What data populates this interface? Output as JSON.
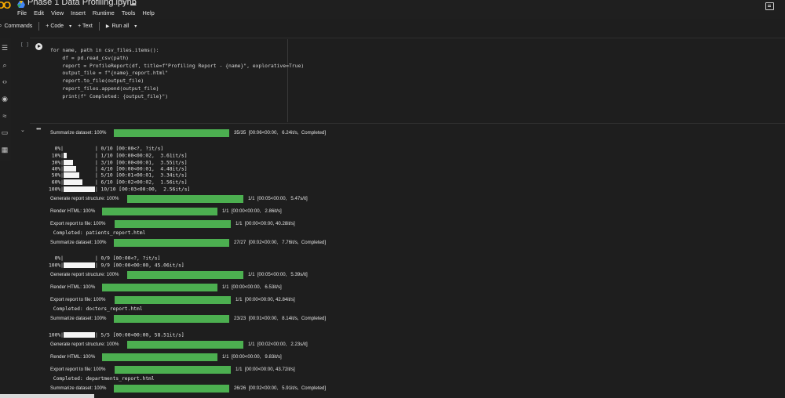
{
  "app": {
    "title": "Phase 1 Data Profiling.ipynb"
  },
  "menu": [
    "File",
    "Edit",
    "View",
    "Insert",
    "Runtime",
    "Tools",
    "Help"
  ],
  "toolbar": {
    "commands_label": "Commands",
    "code_label": "+ Code",
    "text_label": "+ Text",
    "run_all_label": "Run all"
  },
  "cell": {
    "bracket": "[ ]",
    "code_lines": [
      "for name, path in csv_files.items():",
      "    df = pd.read_csv(path)",
      "    report = ProfileReport(df, title=f\"Profiling Report - {name}\", explorative=True)",
      "    output_file = f\"{name}_report.html\"",
      "    report.to_file(output_file)",
      "    report_files.append(output_file)",
      "    print(f\" Completed: {output_file}\")"
    ]
  },
  "output": {
    "menu_glyph": "•••",
    "rows": [
      {
        "type": "progress",
        "label": "Summarize dataset: 100%",
        "fraction": 1.0,
        "stat": "35/35  [00:06<00:00,   6.24it/s,  Completed]"
      },
      {
        "type": "text",
        "text": ""
      },
      {
        "type": "mono",
        "text": "  0%|          | 0/10 [00:00<?, ?it/s]",
        "fraction": 0.0
      },
      {
        "type": "mono",
        "text": " 10%|█         | 1/10 [00:00<00:02,  3.61it/s]",
        "fraction": 0.1
      },
      {
        "type": "mono",
        "text": " 30%|███       | 3/10 [00:00<00:01,  3.55it/s]",
        "fraction": 0.3
      },
      {
        "type": "mono",
        "text": " 40%|████      | 4/10 [00:00<00:01,  4.48it/s]",
        "fraction": 0.4
      },
      {
        "type": "mono",
        "text": " 50%|█████     | 5/10 [00:01<00:01,  3.34it/s]",
        "fraction": 0.5
      },
      {
        "type": "mono",
        "text": " 60%|██████    | 6/10 [00:02<00:02,  1.56it/s]",
        "fraction": 0.6
      },
      {
        "type": "mono",
        "text": "100%|██████████| 10/10 [00:03<00:00,  2.56it/s]",
        "fraction": 1.0
      },
      {
        "type": "progress",
        "label": "Generate report structure: 100%",
        "fraction": 1.0,
        "stat": "1/1  [00:05<00:00,   5.47s/it]"
      },
      {
        "type": "progress",
        "label": "Render HTML: 100%",
        "fraction": 1.0,
        "stat": "1/1  [00:00<00:00,   2.86it/s]"
      },
      {
        "type": "progress",
        "label": "Export report to file: 100%",
        "fraction": 1.0,
        "stat": "1/1  [00:00<00:00, 40.28it/s]"
      },
      {
        "type": "text",
        "text": " Completed: patients_report.html"
      },
      {
        "type": "progress",
        "label": "Summarize dataset: 100%",
        "fraction": 1.0,
        "stat": "27/27  [00:02<00:00,   7.76it/s,  Completed]"
      },
      {
        "type": "text",
        "text": ""
      },
      {
        "type": "mono",
        "text": "  0%|          | 0/9 [00:00<?, ?it/s]",
        "fraction": 0.0
      },
      {
        "type": "mono",
        "text": "100%|██████████| 9/9 [00:00<00:00, 45.06it/s]",
        "fraction": 1.0
      },
      {
        "type": "progress",
        "label": "Generate report structure: 100%",
        "fraction": 1.0,
        "stat": "1/1  [00:05<00:00,   5.39s/it]"
      },
      {
        "type": "progress",
        "label": "Render HTML: 100%",
        "fraction": 1.0,
        "stat": "1/1  [00:00<00:00,   6.53it/s]"
      },
      {
        "type": "progress",
        "label": "Export report to file: 100%",
        "fraction": 1.0,
        "stat": "1/1  [00:00<00:00, 42.84it/s]"
      },
      {
        "type": "text",
        "text": " Completed: doctors_report.html"
      },
      {
        "type": "progress",
        "label": "Summarize dataset: 100%",
        "fraction": 1.0,
        "stat": "23/23  [00:01<00:00,   8.14it/s,  Completed]"
      },
      {
        "type": "text",
        "text": ""
      },
      {
        "type": "mono",
        "text": "100%|██████████| 5/5 [00:00<00:00, 58.51it/s]",
        "fraction": 1.0
      },
      {
        "type": "progress",
        "label": "Generate report structure: 100%",
        "fraction": 1.0,
        "stat": "1/1  [00:02<00:00,   2.23s/it]"
      },
      {
        "type": "progress",
        "label": "Render HTML: 100%",
        "fraction": 1.0,
        "stat": "1/1  [00:00<00:00,   9.83it/s]"
      },
      {
        "type": "progress",
        "label": "Export report to file: 100%",
        "fraction": 1.0,
        "stat": "1/1  [00:00<00:00, 43.72it/s]"
      },
      {
        "type": "text",
        "text": " Completed: departments_report.html"
      },
      {
        "type": "progress",
        "label": "Summarize dataset: 100%",
        "fraction": 1.0,
        "stat": "26/26  [00:02<00:00,   5.91it/s,  Completed]"
      }
    ]
  },
  "colors": {
    "progress_fill": "#4caf50",
    "background": "#1e1e1e",
    "accent_logo": "#f9ab00"
  },
  "icons": [
    "colab-logo-icon",
    "drive-icon",
    "star-icon",
    "cloud-icon",
    "comment-icon",
    "search-icon",
    "toc-icon",
    "find-icon",
    "code-icon",
    "secrets-icon",
    "variables-icon",
    "files-icon",
    "terminal-icon",
    "run-icon",
    "chevron-down-icon"
  ]
}
